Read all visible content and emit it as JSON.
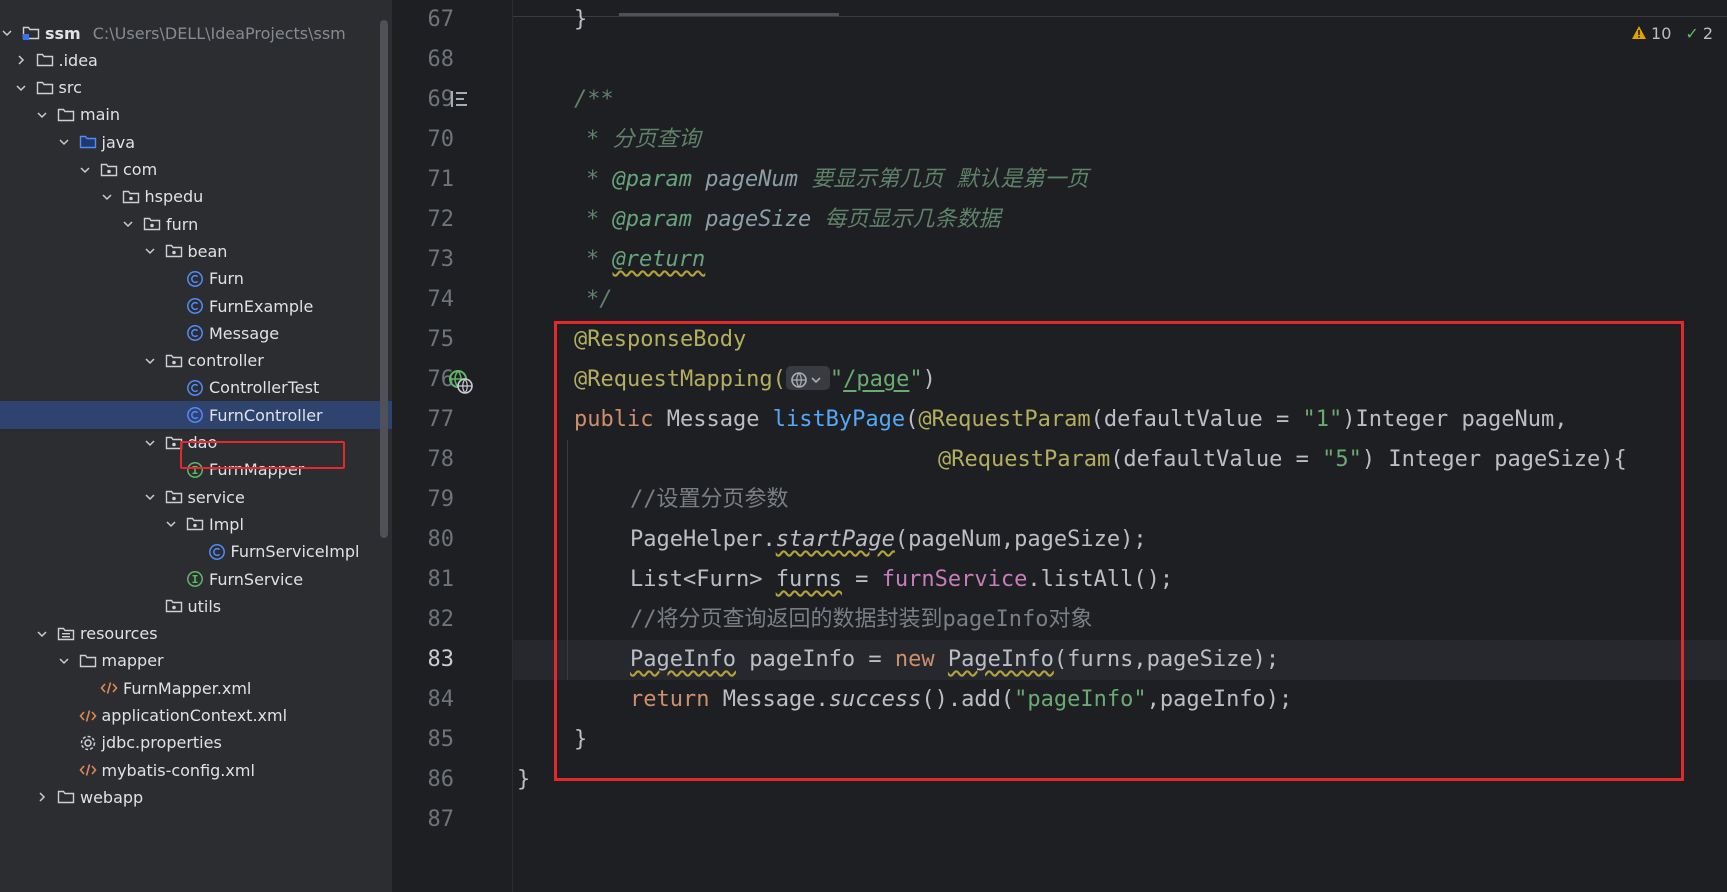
{
  "project": {
    "root_name": "ssm",
    "root_path": "C:\\Users\\DELL\\IdeaProjects\\ssm"
  },
  "tree": [
    {
      "label": "ssm",
      "depth": 0,
      "icon": "module-icon",
      "expanded": true
    },
    {
      "label": ".idea",
      "depth": 1,
      "icon": "folder-icon",
      "expanded": false
    },
    {
      "label": "src",
      "depth": 1,
      "icon": "folder-icon",
      "expanded": true
    },
    {
      "label": "main",
      "depth": 2,
      "icon": "folder-icon",
      "expanded": true
    },
    {
      "label": "java",
      "depth": 3,
      "icon": "source-folder-icon",
      "expanded": true
    },
    {
      "label": "com",
      "depth": 4,
      "icon": "package-icon",
      "expanded": true
    },
    {
      "label": "hspedu",
      "depth": 5,
      "icon": "package-icon",
      "expanded": true
    },
    {
      "label": "furn",
      "depth": 6,
      "icon": "package-icon",
      "expanded": true
    },
    {
      "label": "bean",
      "depth": 7,
      "icon": "package-icon",
      "expanded": true
    },
    {
      "label": "Furn",
      "depth": 8,
      "icon": "class-icon"
    },
    {
      "label": "FurnExample",
      "depth": 8,
      "icon": "class-icon"
    },
    {
      "label": "Message",
      "depth": 8,
      "icon": "class-icon"
    },
    {
      "label": "controller",
      "depth": 7,
      "icon": "package-icon",
      "expanded": true
    },
    {
      "label": "ControllerTest",
      "depth": 8,
      "icon": "class-icon"
    },
    {
      "label": "FurnController",
      "depth": 8,
      "icon": "class-icon",
      "selected": true
    },
    {
      "label": "dao",
      "depth": 7,
      "icon": "package-icon",
      "expanded": true
    },
    {
      "label": "FurnMapper",
      "depth": 8,
      "icon": "interface-icon"
    },
    {
      "label": "service",
      "depth": 7,
      "icon": "package-icon",
      "expanded": true
    },
    {
      "label": "Impl",
      "depth": 8,
      "icon": "package-icon",
      "expanded": true
    },
    {
      "label": "FurnServiceImpl",
      "depth": 9,
      "icon": "class-icon"
    },
    {
      "label": "FurnService",
      "depth": 8,
      "icon": "interface-icon"
    },
    {
      "label": "utils",
      "depth": 7,
      "icon": "package-icon"
    },
    {
      "label": "resources",
      "depth": 2,
      "icon": "resources-folder-icon",
      "expanded": true
    },
    {
      "label": "mapper",
      "depth": 3,
      "icon": "folder-icon",
      "expanded": true
    },
    {
      "label": "FurnMapper.xml",
      "depth": 4,
      "icon": "xml-icon"
    },
    {
      "label": "applicationContext.xml",
      "depth": 3,
      "icon": "xml-icon"
    },
    {
      "label": "jdbc.properties",
      "depth": 3,
      "icon": "properties-icon"
    },
    {
      "label": "mybatis-config.xml",
      "depth": 3,
      "icon": "xml-icon"
    },
    {
      "label": "webapp",
      "depth": 2,
      "icon": "folder-icon",
      "expanded": false
    }
  ],
  "inspections": {
    "warnings": "10",
    "passed": "2",
    "warning_color": "#e0a400",
    "ok_color": "#5fb865"
  },
  "editor": {
    "current_line": "83",
    "line_numbers": [
      "67",
      "68",
      "69",
      "70",
      "71",
      "72",
      "73",
      "74",
      "75",
      "76",
      "77",
      "78",
      "79",
      "80",
      "81",
      "82",
      "83",
      "84",
      "85",
      "86",
      "87"
    ],
    "line67": "}",
    "l69": "/**",
    "l70_star": "* ",
    "l70_text": "分页查询",
    "l71_star": "* ",
    "l71_tag": "@param",
    "l71_name": "pageNum",
    "l71_text": "要显示第几页 默认是第一页",
    "l72_star": "* ",
    "l72_tag": "@param",
    "l72_name": "pageSize",
    "l72_text": "每页显示几条数据",
    "l73_star": "* ",
    "l73_tag": "@return",
    "l74": "*/",
    "l75": "@ResponseBody",
    "l76_annot": "@RequestMapping(",
    "l76_q1": "\"",
    "l76_path": "/page",
    "l76_q2": "\"",
    "l76_close": ")",
    "l77_kw": "public",
    "l77_type": "Message",
    "l77_fn": "listByPage",
    "l77_paren": "(",
    "l77_annot": "@RequestParam",
    "l77_attr": "(defaultValue = ",
    "l77_str": "\"1\"",
    "l77_rest": ")Integer pageNum,",
    "l78_annot": "@RequestParam",
    "l78_attr": "(defaultValue = ",
    "l78_str": "\"5\"",
    "l78_rest": ") Integer pageSize){",
    "l79": "//设置分页参数",
    "l80_cls": "PageHelper.",
    "l80_method": "startPage",
    "l80_rest": "(pageNum,pageSize);",
    "l81_type": "List<Furn> ",
    "l81_var": "furns",
    "l81_eq": " = ",
    "l81_field": "furnService",
    "l81_rest": ".listAll();",
    "l82": "//将分页查询返回的数据封装到pageInfo对象",
    "l83_type": "PageInfo",
    "l83_mid": " pageInfo = ",
    "l83_kw": "new",
    "l83_ctor": "PageInfo",
    "l83_rest": "(furns,pageSize);",
    "l84_kw": "return",
    "l84_cls": " Message.",
    "l84_method": "success",
    "l84_mid": "().add(",
    "l84_str": "\"pageInfo\"",
    "l84_rest": ",pageInfo);",
    "l85": "}",
    "l86": "}"
  }
}
